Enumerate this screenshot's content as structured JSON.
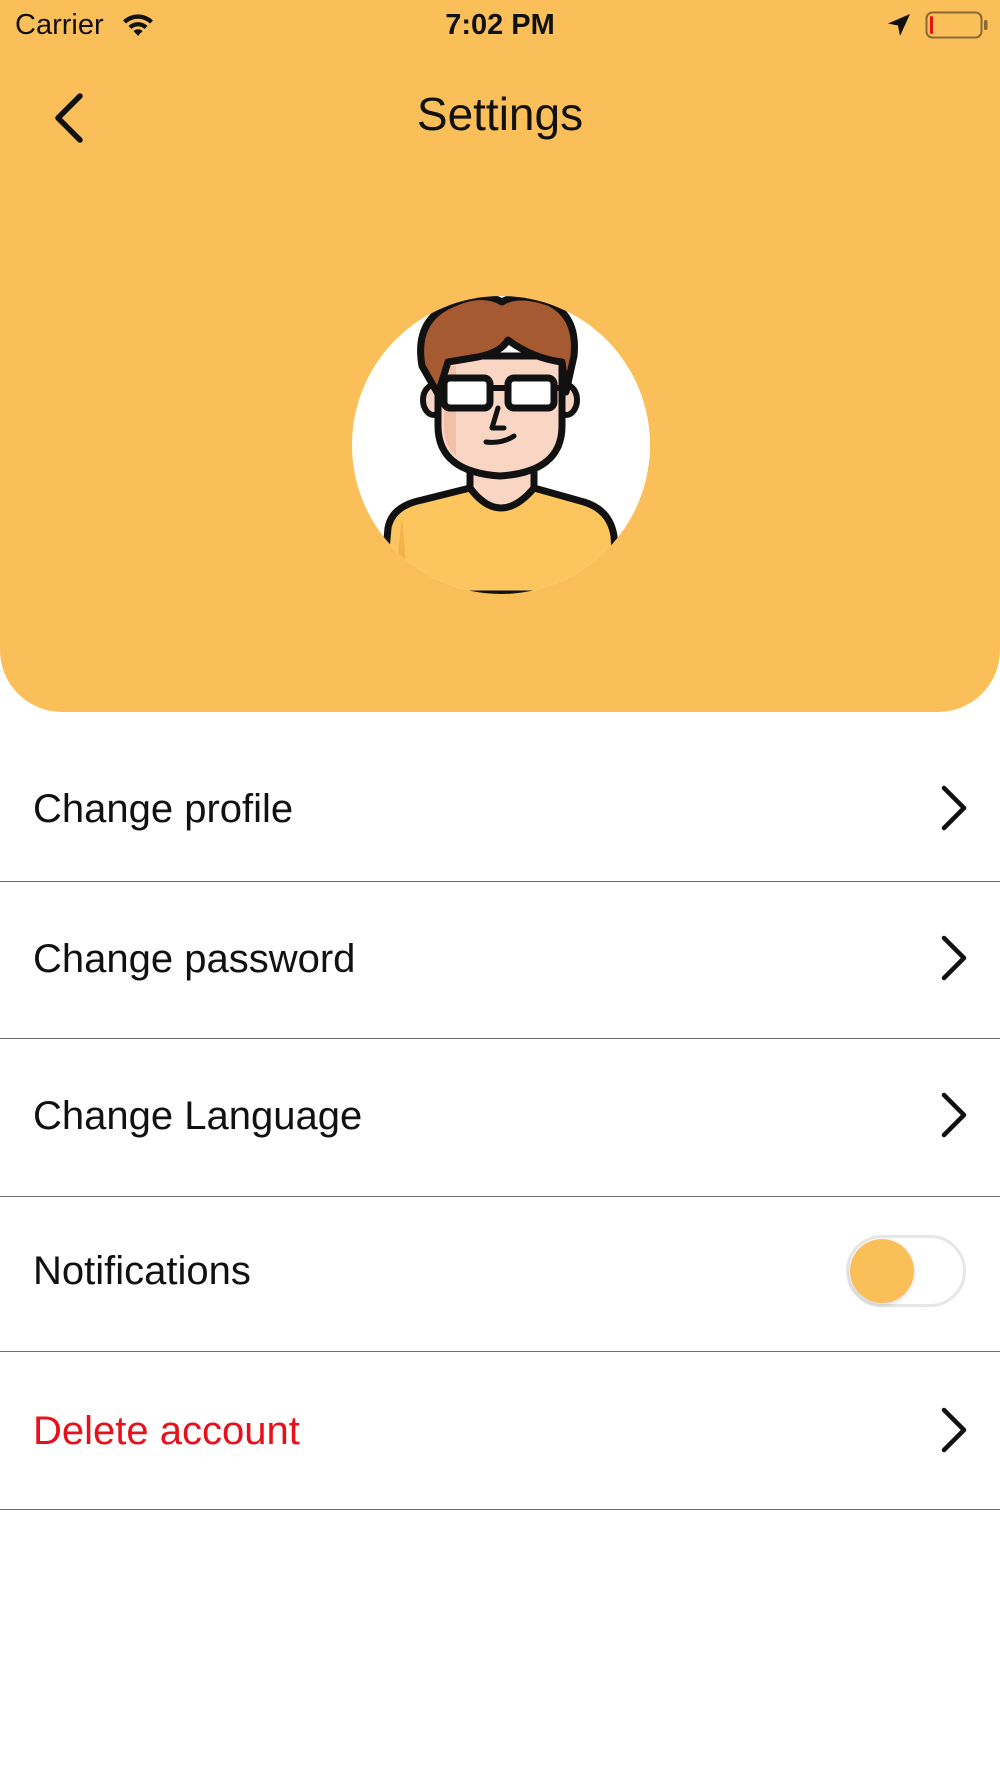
{
  "status_bar": {
    "carrier": "Carrier",
    "time": "7:02 PM",
    "wifi_icon": "wifi-icon",
    "location_icon": "location-arrow-icon",
    "battery_icon": "battery-low-icon",
    "battery_level_fraction": 0.05
  },
  "header": {
    "title": "Settings",
    "back_icon": "chevron-left-icon",
    "background_color": "#FBBF5A"
  },
  "profile": {
    "avatar_icon": "user-avatar-illustration"
  },
  "settings": {
    "items": [
      {
        "label": "Change profile",
        "control": "chevron-right-icon"
      },
      {
        "label": "Change password",
        "control": "chevron-right-icon"
      },
      {
        "label": "Change Language",
        "control": "chevron-right-icon"
      },
      {
        "label": "Notifications",
        "control": "toggle",
        "toggle_on": false
      },
      {
        "label": "Delete account",
        "control": "chevron-right-icon",
        "label_color": "#E8101A"
      }
    ]
  },
  "colors": {
    "accent": "#FBBF5A",
    "danger": "#E8101A",
    "divider": "#6F6F6F"
  }
}
